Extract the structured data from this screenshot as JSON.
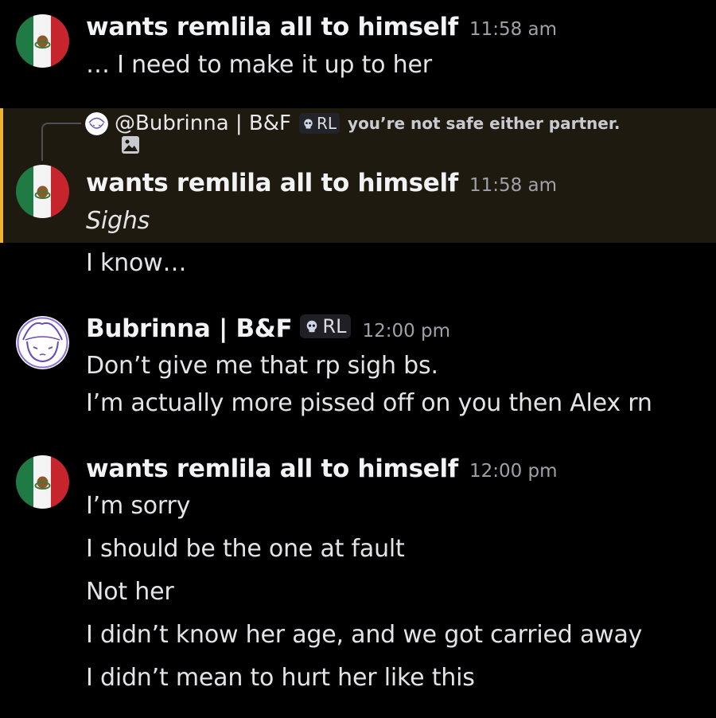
{
  "users": {
    "wants": {
      "name": "wants remlila all to himself",
      "avatar_icon": "mexico-flag-icon"
    },
    "bubrinna": {
      "name": "Bubrinna | B&F",
      "role": "RL",
      "avatar_icon": "girl-doodle-avatar-icon"
    }
  },
  "messages": [
    {
      "author": "wants remlila all to himself",
      "time": "11:58 am",
      "lines": [
        "… I need to make it up to her"
      ]
    },
    {
      "reply_to": {
        "name": "@Bubrinna | B&F",
        "role": "RL",
        "text": "you’re not safe either partner.",
        "attachment_icon": "image-icon"
      },
      "author": "wants remlila all to himself",
      "time": "11:58 am",
      "lines": [
        "Sighs",
        "I know…"
      ]
    },
    {
      "author": "Bubrinna | B&F",
      "role": "RL",
      "time": "12:00 pm",
      "lines": [
        "Don’t give me that rp sigh bs.",
        "I’m actually more pissed off on you then Alex rn"
      ]
    },
    {
      "author": "wants remlila all to himself",
      "time": "12:00 pm",
      "lines": [
        "I’m sorry",
        "I should be the one at fault",
        "Not her",
        "I didn’t know her age, and we got carried away",
        "I didn’t mean to hurt her like this"
      ]
    }
  ],
  "colors": {
    "background": "#000000",
    "mention_highlight": "#1f1a10",
    "mention_bar": "#f0b232",
    "timestamp": "#a0a1a8"
  }
}
